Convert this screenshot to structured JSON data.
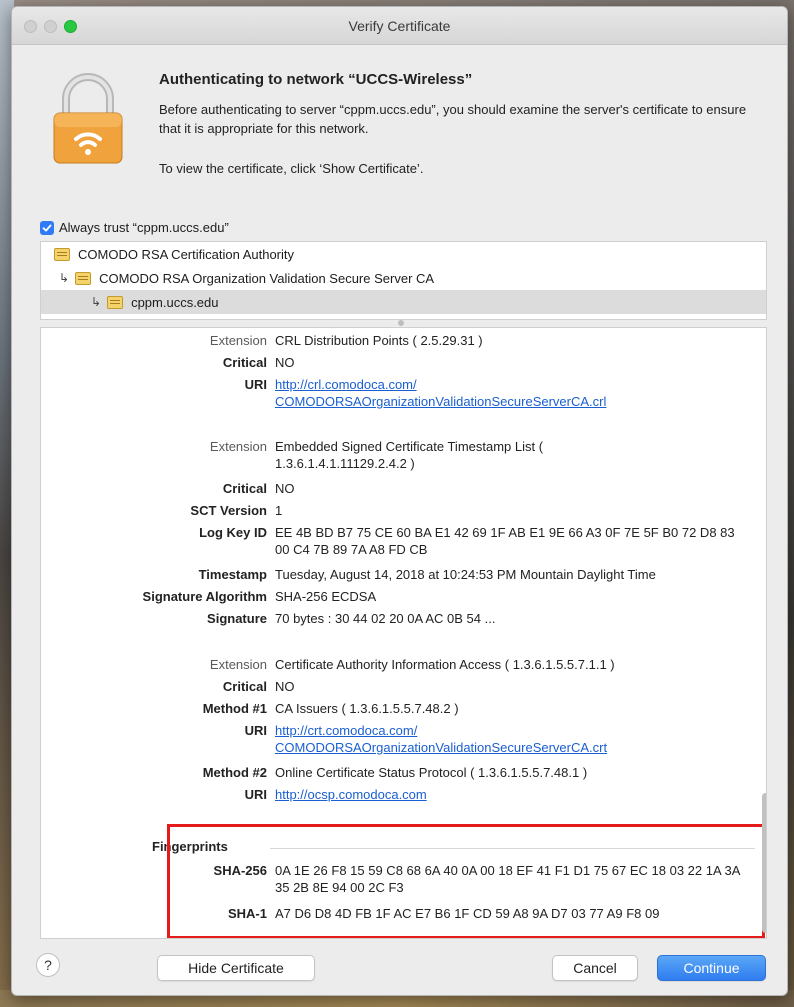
{
  "window": {
    "title": "Verify Certificate"
  },
  "header": {
    "heading": "Authenticating to network “UCCS-Wireless”",
    "message": "Before authenticating to server “cppm.uccs.edu”, you should examine the server's certificate to ensure that it is appropriate for this network.",
    "instruction": "To view the certificate, click ‘Show Certificate’."
  },
  "trust": {
    "label": "Always trust “cppm.uccs.edu”",
    "checked": true
  },
  "tree": {
    "items": [
      {
        "label": "COMODO RSA Certification Authority"
      },
      {
        "label": "COMODO RSA Organization Validation Secure Server CA"
      },
      {
        "label": "cppm.uccs.edu"
      }
    ]
  },
  "details": {
    "rows": [
      {
        "label": "Extension",
        "value": "CRL Distribution Points ( 2.5.29.31 )"
      },
      {
        "label": "Critical",
        "value": "NO"
      },
      {
        "label": "URI",
        "value": "http://crl.comodoca.com/COMODORSAOrganizationValidationSecureServerCA.crl"
      },
      {
        "label": "Extension",
        "value": "Embedded Signed Certificate Timestamp List ( 1.3.6.1.4.1.11129.2.4.2 )"
      },
      {
        "label": "Critical",
        "value": "NO"
      },
      {
        "label": "SCT Version",
        "value": "1"
      },
      {
        "label": "Log Key ID",
        "value": "EE 4B BD B7 75 CE 60 BA E1 42 69 1F AB E1 9E 66 A3 0F 7E 5F B0 72 D8 83 00 C4 7B 89 7A A8 FD CB"
      },
      {
        "label": "Timestamp",
        "value": "Tuesday, August 14, 2018 at 10:24:53 PM Mountain Daylight Time"
      },
      {
        "label": "Signature Algorithm",
        "value": "SHA-256 ECDSA"
      },
      {
        "label": "Signature",
        "value": "70 bytes : 30 44 02 20 0A AC 0B 54 ..."
      },
      {
        "label": "Extension",
        "value": "Certificate Authority Information Access ( 1.3.6.1.5.5.7.1.1 )"
      },
      {
        "label": "Critical",
        "value": "NO"
      },
      {
        "label": "Method #1",
        "value": "CA Issuers ( 1.3.6.1.5.5.7.48.2 )"
      },
      {
        "label": "URI",
        "value": "http://crt.comodoca.com/COMODORSAOrganizationValidationSecureServerCA.crt"
      },
      {
        "label": "Method #2",
        "value": "Online Certificate Status Protocol ( 1.3.6.1.5.5.7.48.1 )"
      },
      {
        "label": "URI",
        "value": "http://ocsp.comodoca.com"
      }
    ],
    "fingerprints": {
      "title": "Fingerprints",
      "sha256_label": "SHA-256",
      "sha256": "0A 1E 26 F8 15 59 C8 68 6A 40 0A 00 18 EF 41 F1 D1 75 67 EC 18 03 22 1A 3A 35 2B 8E 94 00 2C F3",
      "sha1_label": "SHA-1",
      "sha1": "A7 D6 D8 4D FB 1F AC E7 B6 1F CD 59 A8 9A D7 03 77 A9 F8 09"
    }
  },
  "footer": {
    "help": "?",
    "hide_certificate": "Hide Certificate",
    "cancel": "Cancel",
    "continue": "Continue"
  },
  "colors": {
    "accent": "#2f7df0",
    "highlight": "#e51b1b",
    "link": "#1a5fd1"
  }
}
